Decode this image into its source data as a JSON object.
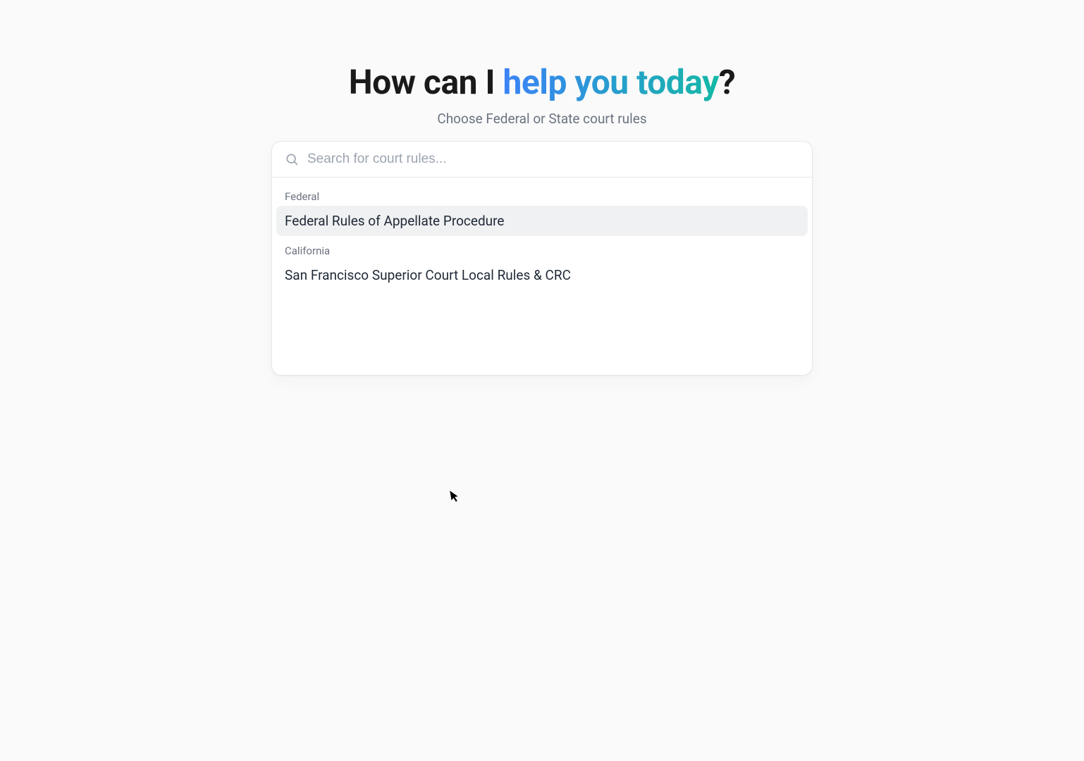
{
  "heading": {
    "prefix": "How can I ",
    "gradient": "help you today",
    "suffix": "?"
  },
  "subtitle": "Choose Federal or State court rules",
  "search": {
    "placeholder": "Search for court rules...",
    "value": ""
  },
  "groups": [
    {
      "label": "Federal",
      "items": [
        {
          "label": "Federal Rules of Appellate Procedure",
          "highlighted": true
        }
      ]
    },
    {
      "label": "California",
      "items": [
        {
          "label": "San Francisco Superior Court Local Rules & CRC",
          "highlighted": false
        }
      ]
    }
  ]
}
